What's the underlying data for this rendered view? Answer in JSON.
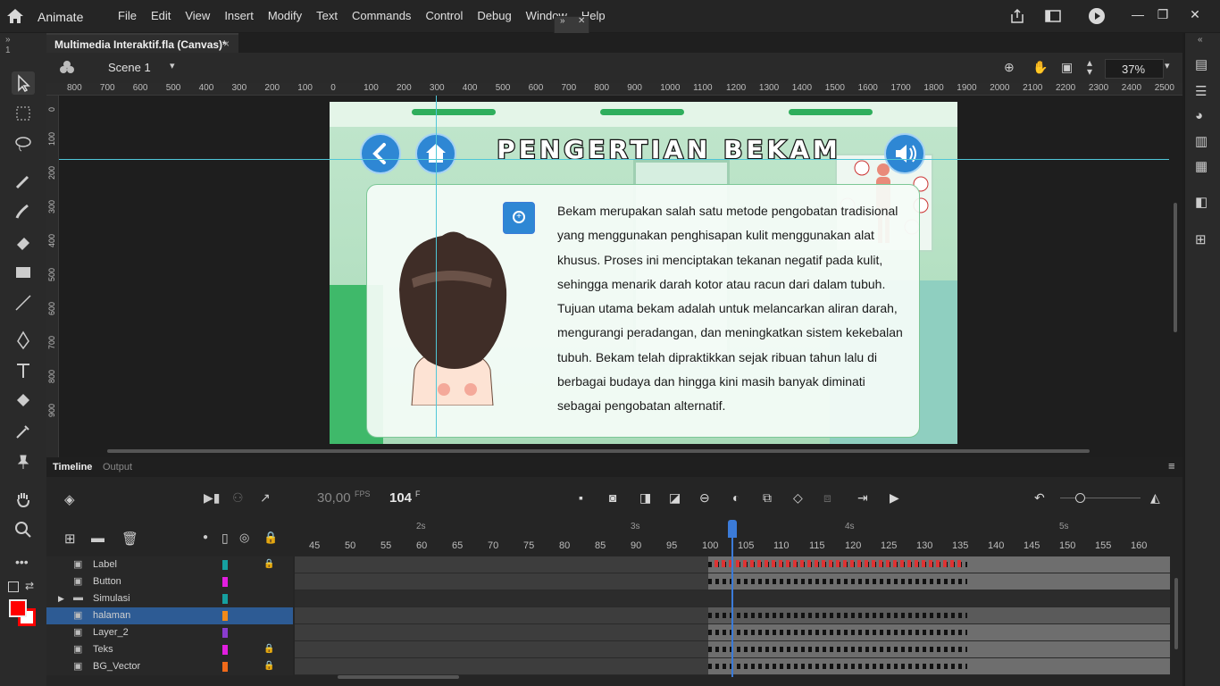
{
  "app": {
    "name": "Animate"
  },
  "menu": {
    "items": [
      "File",
      "Edit",
      "View",
      "Insert",
      "Modify",
      "Text",
      "Commands",
      "Control",
      "Debug",
      "Window",
      "Help"
    ]
  },
  "document": {
    "tab_title": "Multimedia Interaktif.fla (Canvas)*",
    "close": "×"
  },
  "scene": {
    "name": "Scene 1",
    "zoom": "37%"
  },
  "ruler_h": [
    "800",
    "700",
    "600",
    "500",
    "400",
    "300",
    "200",
    "100",
    "0",
    "100",
    "200",
    "300",
    "400",
    "500",
    "600",
    "700",
    "800",
    "900",
    "1000",
    "1100",
    "1200",
    "1300",
    "1400",
    "1500",
    "1600",
    "1700",
    "1800",
    "1900",
    "2000",
    "2100",
    "2200",
    "2300",
    "2400",
    "2500"
  ],
  "ruler_v": [
    "0",
    "100",
    "200",
    "300",
    "400",
    "500",
    "600",
    "700",
    "800",
    "900"
  ],
  "stage": {
    "title": "PENGERTIAN BEKAM",
    "body": "Bekam merupakan salah satu metode pengobatan tradisional yang menggunakan penghisapan kulit menggunakan alat khusus. Proses ini menciptakan tekanan negatif pada kulit, sehingga menarik darah kotor atau racun dari dalam tubuh. Tujuan utama bekam adalah untuk melancarkan aliran darah, mengurangi peradangan, dan meningkatkan sistem kekebalan tubuh. Bekam telah dipraktikkan sejak ribuan tahun lalu di berbagai budaya dan hingga kini masih banyak diminati sebagai pengobatan alternatif."
  },
  "timeline": {
    "tabs": [
      "Timeline",
      "Output"
    ],
    "fps": "30,00",
    "fps_unit": "FPS",
    "frame": "104",
    "frame_unit": "F",
    "seconds": [
      "2s",
      "3s",
      "4s",
      "5s"
    ],
    "frame_numbers": [
      "45",
      "50",
      "55",
      "60",
      "65",
      "70",
      "75",
      "80",
      "85",
      "90",
      "95",
      "100",
      "105",
      "110",
      "115",
      "120",
      "125",
      "130",
      "135",
      "140",
      "145",
      "150",
      "155",
      "160"
    ],
    "layers": [
      {
        "name": "Label",
        "color": "#16a0a0",
        "locked": true,
        "selected": false,
        "folder": false
      },
      {
        "name": "Button",
        "color": "#e21ee0",
        "locked": false,
        "selected": false,
        "folder": false
      },
      {
        "name": "Simulasi",
        "color": "#16a0a0",
        "locked": false,
        "selected": false,
        "folder": true
      },
      {
        "name": "halaman",
        "color": "#f08a1a",
        "locked": false,
        "selected": true,
        "folder": false
      },
      {
        "name": "Layer_2",
        "color": "#8a3ccf",
        "locked": false,
        "selected": false,
        "folder": false
      },
      {
        "name": "Teks",
        "color": "#e21ee0",
        "locked": true,
        "selected": false,
        "folder": false
      },
      {
        "name": "BG_Vector",
        "color": "#f06a1a",
        "locked": true,
        "selected": false,
        "folder": false
      }
    ]
  },
  "colors": {
    "accent": "#3b7bd8",
    "fill": "#ff0000",
    "stage_bg": "#d8f1df"
  }
}
